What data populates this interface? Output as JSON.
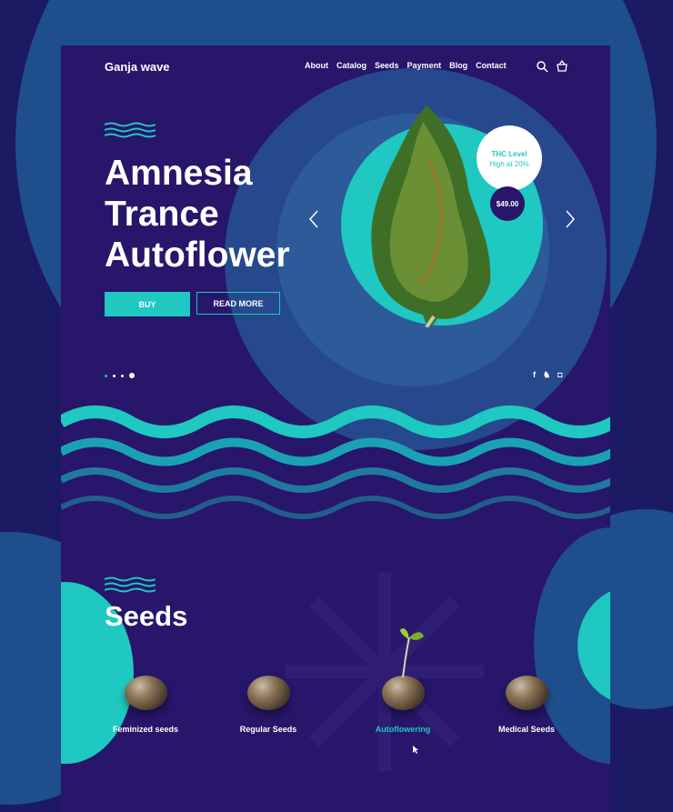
{
  "brand": "Ganja wave",
  "nav": [
    "About",
    "Catalog",
    "Seeds",
    "Payment",
    "Blog",
    "Contact"
  ],
  "header_icons": [
    "search-icon",
    "basket-icon"
  ],
  "hero": {
    "title": "Amnesia Trance Autoflower",
    "buy_label": "BUY",
    "read_more_label": "READ MORE",
    "thc_title": "THC Level",
    "thc_value": "High at 20%",
    "price": "$49.00",
    "slides": 4,
    "active_slide": 4
  },
  "social": [
    "facebook-icon",
    "twitter-icon",
    "instagram-icon"
  ],
  "seeds": {
    "title": "Seeds",
    "items": [
      {
        "label": "Feminized seeds",
        "active": false
      },
      {
        "label": "Regular Seeds",
        "active": false
      },
      {
        "label": "Autoflowering",
        "active": true
      },
      {
        "label": "Medical Seeds",
        "active": false
      }
    ]
  },
  "colors": {
    "background": "#1c1a63",
    "panel": "#27166a",
    "accent": "#1fc8c0",
    "ring": "#1f4f8f",
    "text": "#ffffff"
  }
}
